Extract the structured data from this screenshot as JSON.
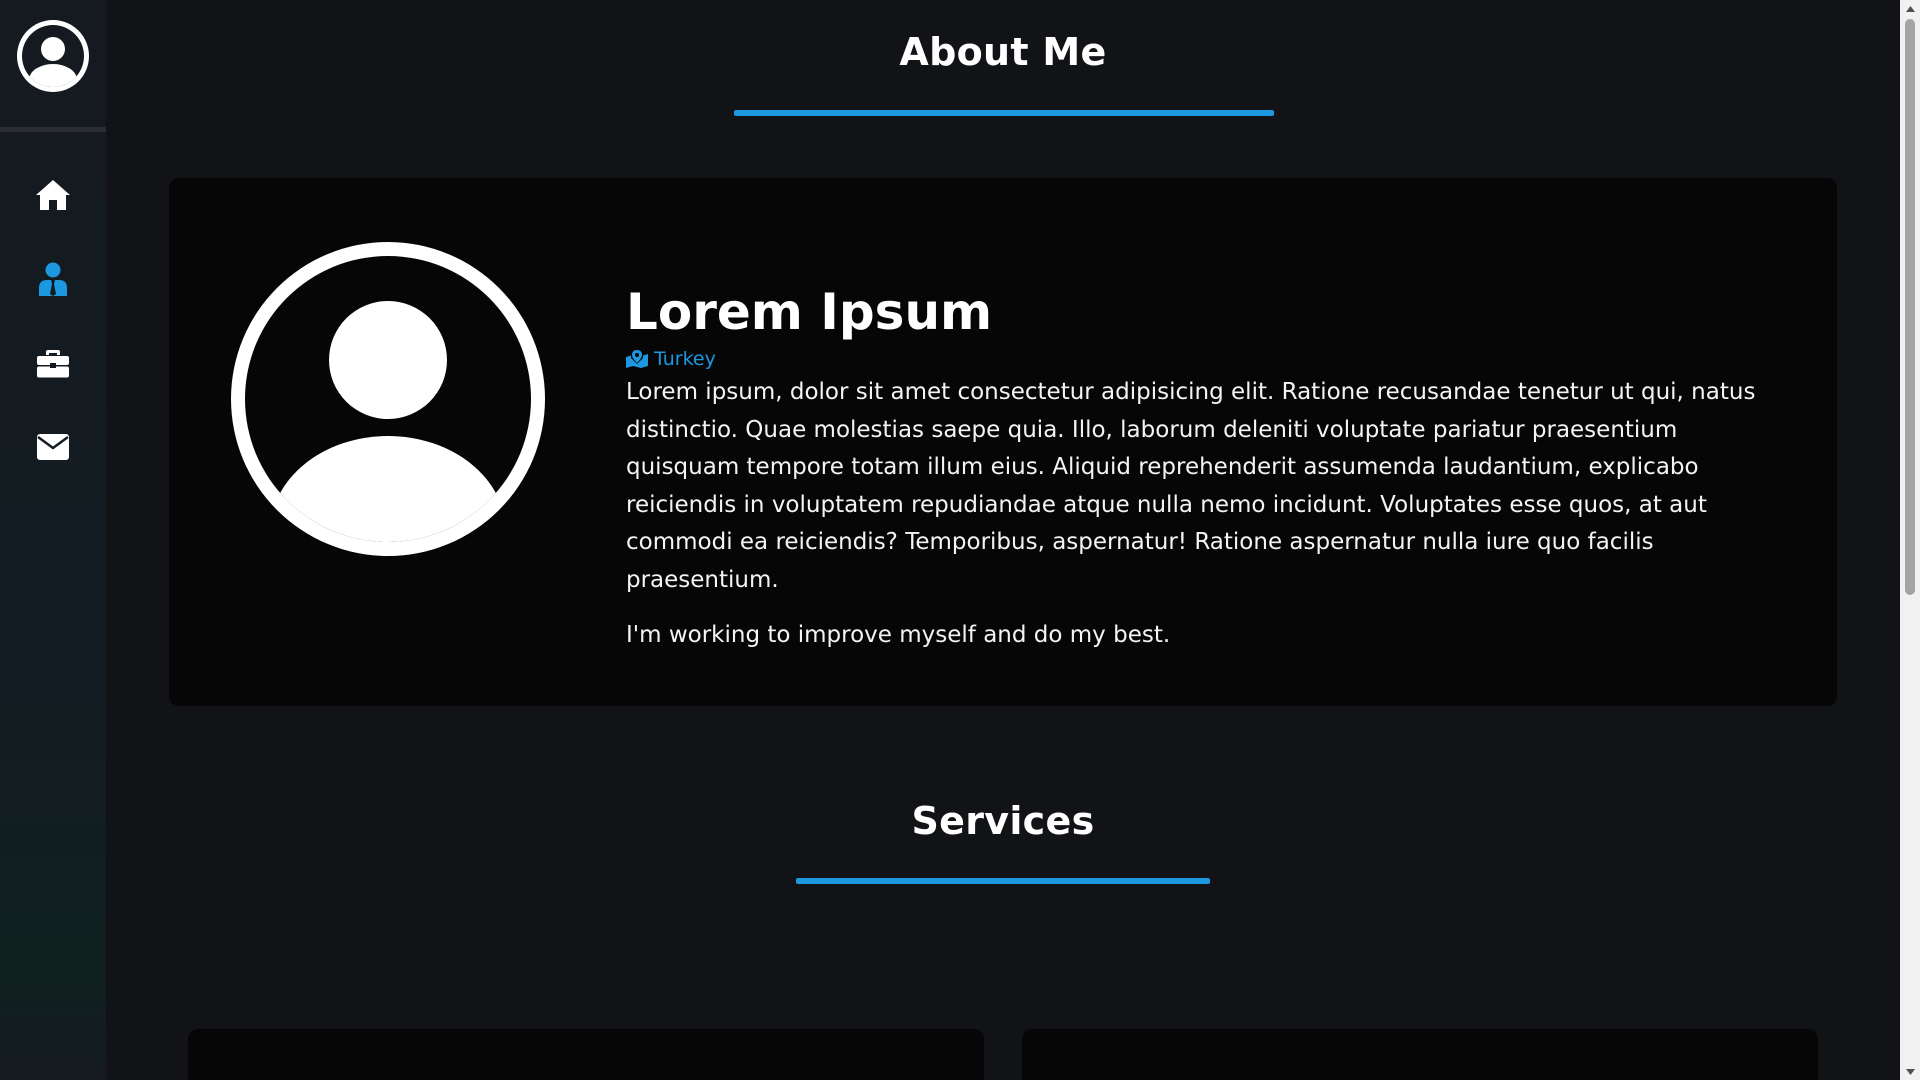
{
  "sidebar": {
    "avatar_icon": "user-circle-icon",
    "items": [
      {
        "icon": "home-icon",
        "active": false
      },
      {
        "icon": "user-tie-icon",
        "active": true
      },
      {
        "icon": "briefcase-icon",
        "active": false
      },
      {
        "icon": "envelope-icon",
        "active": false
      }
    ]
  },
  "about": {
    "title": "About Me",
    "name": "Lorem Ipsum",
    "location": "Turkey",
    "location_icon": "map-marked-icon",
    "bio": "Lorem ipsum, dolor sit amet consectetur adipisicing elit. Ratione recusandae tenetur ut qui, natus distinctio. Quae molestias saepe quia. Illo, laborum deleniti voluptate pariatur praesentium quisquam tempore totam illum eius. Aliquid reprehenderit assumenda laudantium, explicabo reiciendis in voluptatem repudiandae atque nulla nemo incidunt. Voluptates esse quos, at aut commodi ea reiciendis? Temporibus, aspernatur! Ratione aspernatur nulla iure quo facilis praesentium.",
    "motto": "I'm working to improve myself and do my best."
  },
  "services": {
    "title": "Services"
  },
  "colors": {
    "accent": "#1b98e0",
    "background": "#111316",
    "card": "#060606"
  }
}
